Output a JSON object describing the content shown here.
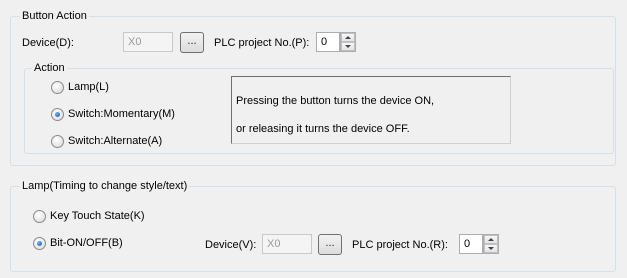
{
  "button_action": {
    "title": "Button Action",
    "device_label": "Device(D):",
    "device_value": "X0",
    "browse_label": "...",
    "plc_label": "PLC project No.(P):",
    "plc_value": "0",
    "action": {
      "title": "Action",
      "options": [
        {
          "label": "Lamp(L)",
          "checked": false
        },
        {
          "label": "Switch:Momentary(M)",
          "checked": true
        },
        {
          "label": "Switch:Alternate(A)",
          "checked": false
        }
      ],
      "description_lines": [
        "Pressing the button turns the device ON,",
        "or releasing it turns the device OFF."
      ]
    }
  },
  "lamp": {
    "title": "Lamp(Timing to change style/text)",
    "options": [
      {
        "label": "Key Touch State(K)",
        "checked": false
      },
      {
        "label": "Bit-ON/OFF(B)",
        "checked": true
      }
    ],
    "device_label": "Device(V):",
    "device_value": "X0",
    "browse_label": "...",
    "plc_label": "PLC project No.(R):",
    "plc_value": "0"
  }
}
